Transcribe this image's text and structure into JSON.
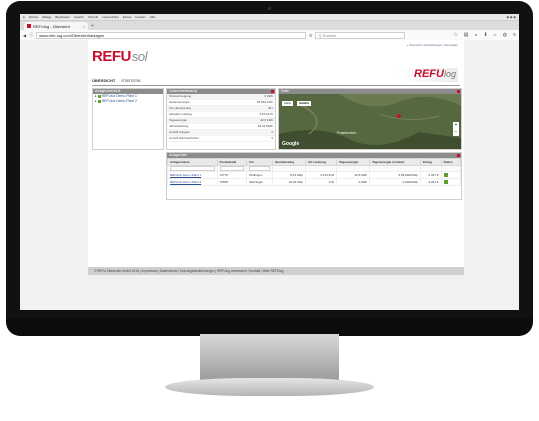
{
  "browser": {
    "menu": [
      "Firefox",
      "Ablage",
      "Bearbeiten",
      "Ansicht",
      "Chronik",
      "Lesezeichen",
      "Extras",
      "Fenster",
      "Hilfe"
    ],
    "tab_title": "REFUlog - Übersicht",
    "url": "www.refu-log.com/Übersicht/anlagen",
    "search_placeholder": "Q Suchen"
  },
  "header": {
    "top_links": "» Übersicht  |  Einstellungen  |  Abmelden",
    "brand_main": "REFU",
    "brand_sub": "sol",
    "logo_main": "REFU",
    "logo_sub": "log"
  },
  "nav": {
    "tab1": "ÜBERSICHT",
    "tab2": "STATISTIK"
  },
  "systems_panel": {
    "title": "Anlagenübersicht",
    "items": [
      "REFUsol Demo-Plant 1",
      "REFUsol Demo-Plant 2"
    ]
  },
  "summary_panel": {
    "title": "Zusammenfassung",
    "rows": [
      {
        "label": "Stromerzeugung",
        "value": "0 kWh"
      },
      {
        "label": "Gesamtenergie",
        "value": "54.881 kWh"
      },
      {
        "label": "CO₂-Einsparung",
        "value": "39 t"
      },
      {
        "label": "Aktuelle Leistung",
        "value": "3.674,8 W"
      },
      {
        "label": "Tagesenergie",
        "value": "42,5 kWh"
      },
      {
        "label": "Jahresleistung",
        "value": "48,44 MWh"
      },
      {
        "label": "Anzahl Anlagen",
        "value": "2"
      },
      {
        "label": "Anzahl Wechselrichter",
        "value": "5"
      }
    ]
  },
  "map_panel": {
    "title": "Karte",
    "btn_map": "Karte",
    "btn_sat": "Satellit",
    "label_country": "Frankreich",
    "google": "Google"
  },
  "plants_panel": {
    "title": "Anlagenliste",
    "columns": [
      "Anlagenname",
      "Postleitzahl",
      "Ort",
      "Nennleistung",
      "AC Leistung",
      "Tagesenergie",
      "Tagesenergie normiert",
      "Ertrag",
      "Status"
    ],
    "rows": [
      {
        "name": "REFUsol Demo-Plant 1",
        "plz": "72770",
        "ort": "Pfullingen",
        "nenn": "8,42 kWp",
        "ac": "3.674,8 W",
        "tag": "42,5 kWh",
        "norm": "5,05 kWh/kWp",
        "ertrag": "2.347 €"
      },
      {
        "name": "REFUsol Demo-Plant 2",
        "plz": "72555",
        "ort": "Metzingen",
        "nenn": "10,03 kWp",
        "ac": "0 W",
        "tag": "0 kWh",
        "norm": "0 kWh/kWp",
        "ertrag": "4.201 €"
      }
    ]
  },
  "footer": {
    "text": "© REFU Elektronik GmbH 2016  |  Impressum  |  Datenschutz  |  Nutzungsbestimmungen  |  REFUlog verbessern  |  Kontakt  |  Über REFUlog"
  },
  "colors": {
    "brand_red": "#c8102e",
    "ok_green": "#5aa02c",
    "panel_header": "#8c8c8c"
  }
}
